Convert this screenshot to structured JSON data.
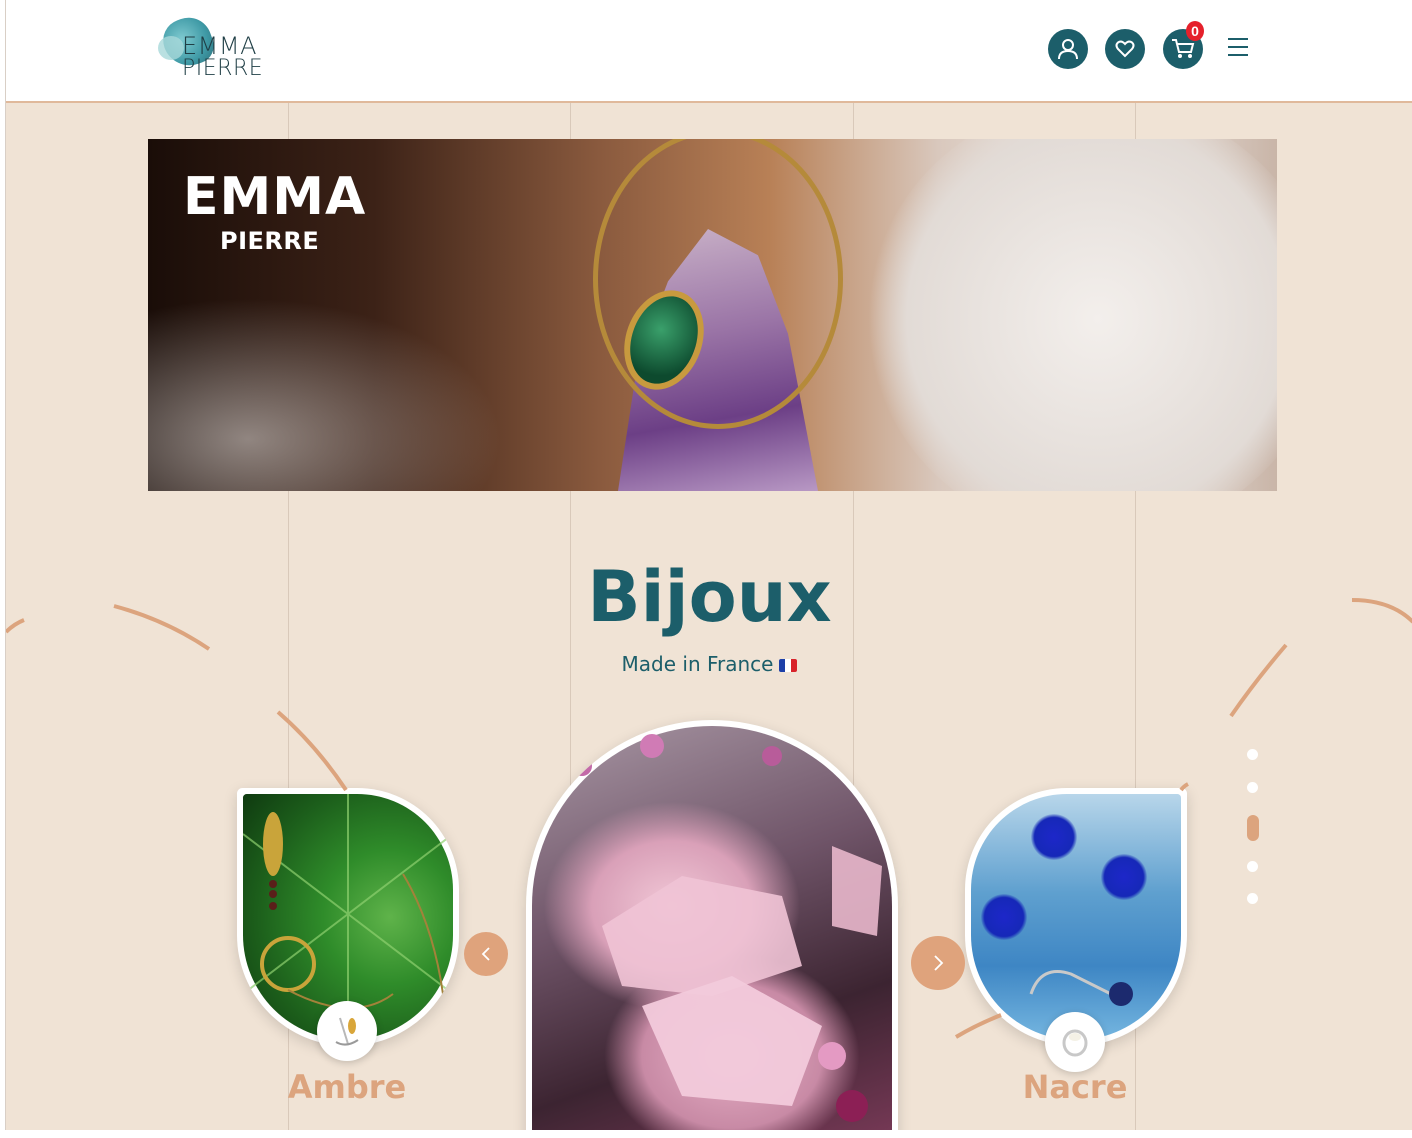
{
  "header": {
    "logo": {
      "line1": "EMMA",
      "line2": "PIERRE"
    },
    "icons": [
      "user-icon",
      "heart-icon",
      "cart-icon",
      "menu-icon"
    ],
    "cart_count": "0"
  },
  "hero": {
    "title": "EMMA",
    "subtitle": "PIERRE"
  },
  "section": {
    "title": "Bijoux",
    "subtitle": "Made in France"
  },
  "carousel": {
    "items": [
      {
        "label": "Ambre"
      },
      {
        "label": ""
      },
      {
        "label": "Nacre"
      }
    ],
    "dots": 5,
    "active_dot": 3
  },
  "colors": {
    "primary": "#1c5e6a",
    "accent": "#dca47e",
    "background": "#f0e3d5",
    "badge": "#e5202b"
  }
}
